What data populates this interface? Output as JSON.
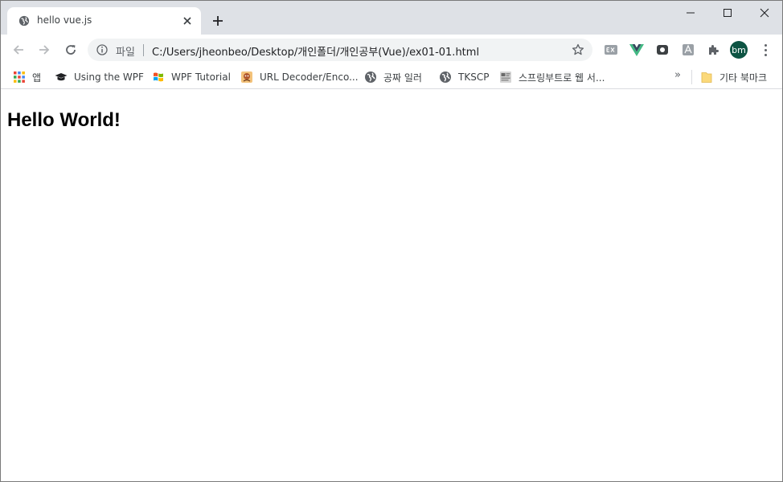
{
  "tab": {
    "title": "hello vue.js",
    "favicon": "globe-icon"
  },
  "toolbar": {
    "scheme_label": "파일",
    "url": "C:/Users/jheonbeo/Desktop/개인폴더/개인공부(Vue)/ex01-01.html",
    "avatar_text": "bm"
  },
  "bookmarks": {
    "items": [
      {
        "label": "앱",
        "icon": "apps-grid-icon"
      },
      {
        "label": "Using the WPF",
        "icon": "graduation-cap-icon"
      },
      {
        "label": "WPF Tutorial",
        "icon": "windows-logo-icon"
      },
      {
        "label": "URL Decoder/Enco...",
        "icon": "site-favicon-icon"
      },
      {
        "label": "공짜 일러",
        "icon": "globe-icon"
      },
      {
        "label": "TKSCP",
        "icon": "globe-icon"
      },
      {
        "label": "스프링부트로 웹 서...",
        "icon": "site-thumbnail-icon"
      }
    ],
    "overflow": "»",
    "other_folder": "기타 북마크"
  },
  "page": {
    "heading": "Hello World!"
  },
  "colors": {
    "tabstrip": "#dee1e6",
    "omnibox": "#f1f3f4",
    "avatar": "#0d5443",
    "vue_green": "#41b883"
  }
}
